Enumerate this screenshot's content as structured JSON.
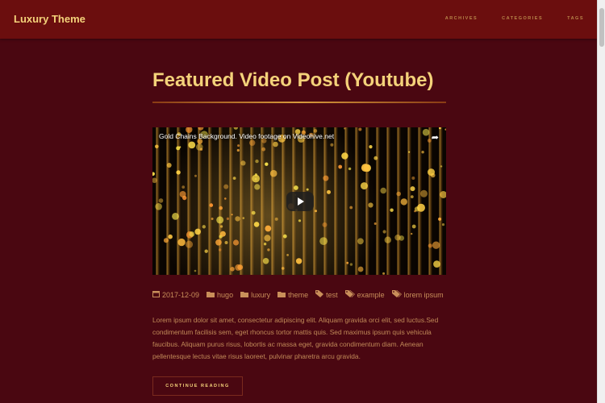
{
  "header": {
    "brand": "Luxury Theme",
    "nav": [
      "ARCHIVES",
      "CATEGORIES",
      "TAGS"
    ]
  },
  "post": {
    "title": "Featured Video Post (Youtube)",
    "video": {
      "title": "Gold Chains Background. Video footage on Videohive.net",
      "share_icon": "share-icon",
      "play_icon": "play-icon"
    },
    "meta": {
      "date": "2017-12-09",
      "categories": [
        "hugo",
        "luxury",
        "theme"
      ],
      "tags": [
        "test",
        "example",
        "lorem ipsum"
      ]
    },
    "excerpt": "Lorem ipsum dolor sit amet, consectetur adipiscing elit. Aliquam gravida orci elit, sed luctus.Sed condimentum facilisis sem, eget rhoncus tortor mattis quis. Sed maximus ipsum quis vehicula faucibus. Aliquam purus risus, lobortis ac massa eget, gravida condimentum diam. Aenean pellentesque lectus vitae risus laoreet, pulvinar pharetra arcu gravida.",
    "continue_label": "CONTINUE READING"
  },
  "colors": {
    "background": "#4a0711",
    "header": "#6b0e0e",
    "gold": "#f4d27a",
    "text": "#c18a58"
  }
}
